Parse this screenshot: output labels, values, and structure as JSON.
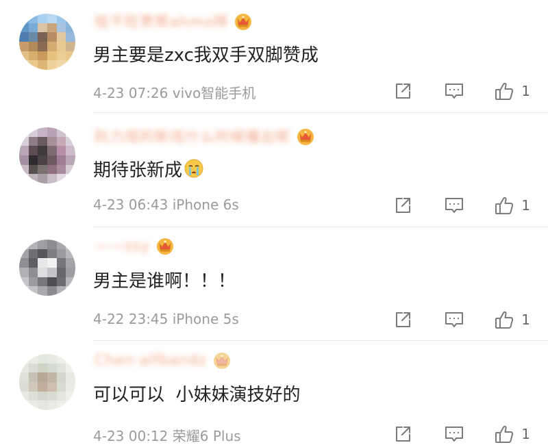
{
  "comments": [
    {
      "username": "桂干旺贾帮ahmo拜",
      "vip": true,
      "text": "男主要是zxc我双手双脚赞成",
      "emoji": "",
      "time": "4-23 07:26",
      "device": "vivo智能手机",
      "likes": "1",
      "avatar_colors": [
        "#6fa6d6",
        "#8bbbe2",
        "#a9d0ee",
        "#b8d9f1",
        "#9cc6e8",
        "#7fb0da",
        "#5f97c9",
        "#7aaad6",
        "#d9c4a3",
        "#c9a57b",
        "#a8c4df",
        "#8ab6de",
        "#4f7fb2",
        "#6b8aa8",
        "#7a6253",
        "#b98e65",
        "#e0c79e",
        "#97b9d9",
        "#c79b6a",
        "#b28959",
        "#8a6a52",
        "#d5ab74",
        "#e9c98f",
        "#cfb58e",
        "#e2bf86",
        "#d8ad6d",
        "#c99a5c",
        "#e6c27f",
        "#eccd94",
        "#e8c88d",
        "#f0d6a1",
        "#e9c98e",
        "#ddb676",
        "#eed09a",
        "#f1d8a8",
        "#efd4a0"
      ]
    },
    {
      "username": "阮力观的新戏什么时候播出呢",
      "vip": true,
      "text": "期待张新成",
      "emoji": "crying-face",
      "time": "4-23 06:43",
      "device": "iPhone 6s",
      "likes": "1",
      "avatar_colors": [
        "#e9e4ea",
        "#d8ccd9",
        "#c7b3c6",
        "#b9a2b6",
        "#d1c2cf",
        "#ece7ee",
        "#d9cfd8",
        "#8e7d86",
        "#6a5a61",
        "#a79098",
        "#c6aab8",
        "#d9d0d9",
        "#b7a5b6",
        "#5c4c52",
        "#3f3a3e",
        "#7e6b74",
        "#b78fa6",
        "#cdbbc9",
        "#a58fa2",
        "#2f2c31",
        "#4a4246",
        "#6e5a62",
        "#9f7e93",
        "#b9a6b7",
        "#c9bcc7",
        "#56504f",
        "#7a736f",
        "#8f6f7e",
        "#a98d9f",
        "#d7ccd6",
        "#e8e2e8",
        "#bdb5bb",
        "#a89ea6",
        "#c8bcc6",
        "#e1d9e0",
        "#f0ecf0"
      ]
    },
    {
      "username": "——ssy",
      "vip": true,
      "text": "男主是谁啊！！！",
      "emoji": "",
      "time": "4-22 23:45",
      "device": "iPhone 5s",
      "likes": "1",
      "avatar_colors": [
        "#c9c9cc",
        "#b4b4b8",
        "#9e9ea3",
        "#8c8c91",
        "#a7a7ab",
        "#cbcbce",
        "#a2a2a7",
        "#6f6f75",
        "#56565c",
        "#7d7d83",
        "#9a9aa0",
        "#b9b9bd",
        "#8d8d93",
        "#5e5e64",
        "#e8e8ea",
        "#f2f2f3",
        "#77777d",
        "#a3a3a8",
        "#b1b1b6",
        "#8e8e94",
        "#dedee1",
        "#c5c5c9",
        "#66666c",
        "#9d9da2",
        "#c6c6ca",
        "#9b9ba0",
        "#76767b",
        "#4e4e54",
        "#6c6c72",
        "#b6b6ba",
        "#dcdcde",
        "#c2c2c6",
        "#a8a8ad",
        "#8b8b90",
        "#b3b3b7",
        "#d6d6d9"
      ]
    },
    {
      "username": "Chen·alfbandz",
      "vip": true,
      "vip_style": "faded",
      "text": "可以可以  小妹妹演技好的",
      "emoji": "",
      "time": "4-23 00:12",
      "device": "荣耀6 Plus",
      "likes": "1",
      "avatar_colors": [
        "#eef1ea",
        "#e8ece3",
        "#e3e8dd",
        "#e6eae0",
        "#ecefe8",
        "#f2f4ef",
        "#e4e8de",
        "#d9ddd1",
        "#cfd3c6",
        "#d6dbcf",
        "#dfe3d8",
        "#eef0ea",
        "#dde1d6",
        "#c6c1b6",
        "#b8a995",
        "#c2b6a5",
        "#d4d7cb",
        "#e7eae2",
        "#d9ddd2",
        "#cfc8bb",
        "#c3ae9c",
        "#cdbfae",
        "#d8dbd0",
        "#e9ece4",
        "#e6e9e1",
        "#dde0d6",
        "#d3d6cb",
        "#d9dcd2",
        "#e2e5dc",
        "#eef0ea",
        "#f1f3ee",
        "#eaede6",
        "#e4e7df",
        "#e8ebe3",
        "#eef0ea",
        "#f4f5f2"
      ]
    }
  ]
}
